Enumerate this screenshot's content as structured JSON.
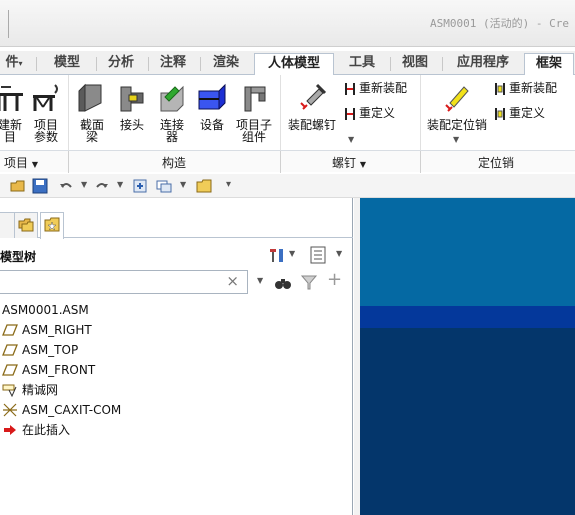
{
  "window": {
    "title": "ASM0001 (活动的) - Cre"
  },
  "tabs": [
    {
      "label": "件"
    },
    {
      "label": "模型"
    },
    {
      "label": "分析"
    },
    {
      "label": "注释"
    },
    {
      "label": "渲染"
    },
    {
      "label": "人体模型"
    },
    {
      "label": "工具"
    },
    {
      "label": "视图"
    },
    {
      "label": "应用程序"
    },
    {
      "label": "框架"
    }
  ],
  "ribbon": {
    "buttons": {
      "new_item_line1": "建新",
      "new_item_line2": "目",
      "item_params_line1": "项目",
      "item_params_line2": "参数",
      "section_beam_line1": "截面",
      "section_beam_line2": "梁",
      "joint": "接头",
      "connector_line1": "连接",
      "connector_line2": "器",
      "equipment": "设备",
      "subassembly_line1": "项目子",
      "subassembly_line2": "组件",
      "assemble_bolt": "装配螺钉",
      "reassemble_bolt": "重新装配",
      "redefine_bolt": "重定义",
      "assemble_pin": "装配定位销",
      "reassemble_pin": "重新装配",
      "redefine_pin": "重定义"
    },
    "groups": {
      "item": "项目",
      "construct": "构造",
      "bolt": "螺钉",
      "pin": "定位销"
    }
  },
  "model_tree": {
    "title": "模型树",
    "search_value": "",
    "clear_symbol": "×",
    "items": [
      {
        "label": "ASM0001.ASM",
        "icon": "assembly-icon"
      },
      {
        "label": "ASM_RIGHT",
        "icon": "datum-plane-icon"
      },
      {
        "label": "ASM_TOP",
        "icon": "datum-plane-icon"
      },
      {
        "label": "ASM_FRONT",
        "icon": "datum-plane-icon"
      },
      {
        "label": "精诚网",
        "icon": "skeleton-part-icon"
      },
      {
        "label": "ASM_CAXIT-COM",
        "icon": "coordinate-system-icon"
      },
      {
        "label": "在此插入",
        "icon": "insert-here-arrow-icon"
      }
    ]
  },
  "colors": {
    "graphics_top": "#0569a3",
    "graphics_band": "#04389b",
    "graphics_bottom": "#04366b",
    "insert_arrow": "#d81a1a"
  }
}
